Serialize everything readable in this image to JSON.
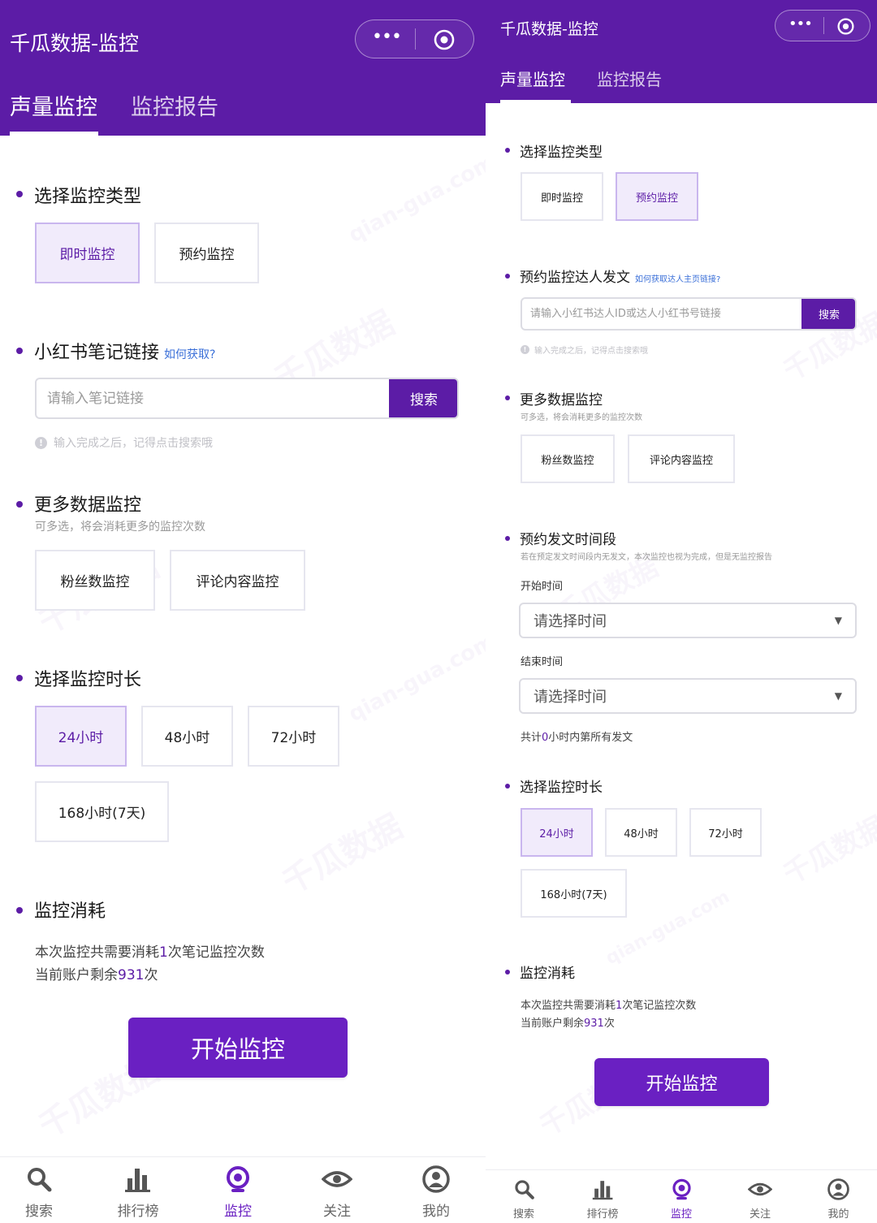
{
  "app": {
    "title": "千瓜数据-监控"
  },
  "tabs": {
    "volume": "声量监控",
    "report": "监控报告"
  },
  "watermark": {
    "cn": "千瓜数据",
    "en": "qian-gua.com"
  },
  "colors": {
    "brand": "#5c1ca6",
    "button": "#6a20c2",
    "link": "#3a6fd8"
  },
  "left": {
    "monitor_type": {
      "title": "选择监控类型",
      "options": [
        "即时监控",
        "预约监控"
      ],
      "selected": "即时监控"
    },
    "note_link": {
      "title": "小红书笔记链接",
      "help": "如何获取?",
      "placeholder": "请输入笔记链接",
      "search": "搜索",
      "hint": "输入完成之后，记得点击搜索哦"
    },
    "more_data": {
      "title": "更多数据监控",
      "subtitle": "可多选，将会消耗更多的监控次数",
      "options": [
        "粉丝数监控",
        "评论内容监控"
      ]
    },
    "duration": {
      "title": "选择监控时长",
      "options": [
        "24小时",
        "48小时",
        "72小时",
        "168小时(7天)"
      ],
      "selected": "24小时"
    },
    "cost": {
      "title": "监控消耗",
      "line1_pre": "本次监控共需要消耗",
      "line1_num": "1",
      "line1_post": "次笔记监控次数",
      "line2_pre": "当前账户剩余",
      "line2_num": "931",
      "line2_post": "次"
    },
    "start_button": "开始监控"
  },
  "right": {
    "monitor_type": {
      "title": "选择监控类型",
      "options": [
        "即时监控",
        "预约监控"
      ],
      "selected": "预约监控"
    },
    "kol": {
      "title": "预约监控达人发文",
      "help": "如何获取达人主页链接?",
      "placeholder": "请输入小红书达人ID或达人小红书号链接",
      "search": "搜索",
      "hint": "输入完成之后，记得点击搜索哦"
    },
    "more_data": {
      "title": "更多数据监控",
      "subtitle": "可多选，将会消耗更多的监控次数",
      "options": [
        "粉丝数监控",
        "评论内容监控"
      ]
    },
    "schedule": {
      "title": "预约发文时间段",
      "subtitle": "若在预定发文时间段内无发文，本次监控也视为完成，但是无监控报告",
      "start_label": "开始时间",
      "end_label": "结束时间",
      "placeholder": "请选择时间",
      "summary_pre": "共计",
      "summary_num": "0",
      "summary_post": "小时内第所有发文"
    },
    "duration": {
      "title": "选择监控时长",
      "options": [
        "24小时",
        "48小时",
        "72小时",
        "168小时(7天)"
      ],
      "selected": "24小时"
    },
    "cost": {
      "title": "监控消耗",
      "line1_pre": "本次监控共需要消耗",
      "line1_num": "1",
      "line1_post": "次笔记监控次数",
      "line2_pre": "当前账户剩余",
      "line2_num": "931",
      "line2_post": "次"
    },
    "start_button": "开始监控"
  },
  "tabbar": [
    {
      "label": "搜索",
      "icon": "search-icon"
    },
    {
      "label": "排行榜",
      "icon": "bar-chart-icon"
    },
    {
      "label": "监控",
      "icon": "monitor-target-icon",
      "active": true
    },
    {
      "label": "关注",
      "icon": "eye-icon"
    },
    {
      "label": "我的",
      "icon": "user-icon"
    }
  ]
}
